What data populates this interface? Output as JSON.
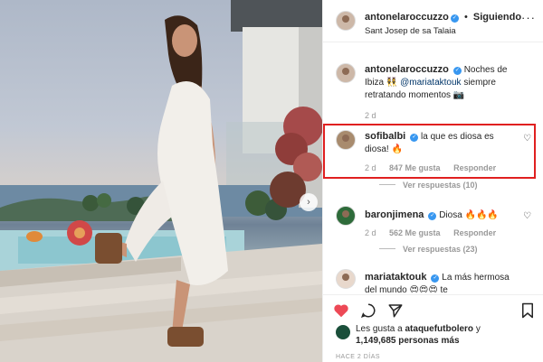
{
  "header": {
    "username": "antonelaroccuzzo",
    "separator": "•",
    "follow_label": "Siguiendo",
    "location": "Sant Josep de sa Talaia"
  },
  "caption": {
    "username": "antonelaroccuzzo",
    "text": "Noches de Ibiza 👯‍♀️ ",
    "mention": "@mariataktouk",
    "text2": " siempre retratando momentos 📷",
    "age": "2 d"
  },
  "comments": [
    {
      "username": "sofibalbi",
      "text": "la que es diosa es diosa! 🔥",
      "age": "2 d",
      "likes": "847 Me gusta",
      "reply": "Responder",
      "view_replies": "Ver respuestas (10)"
    },
    {
      "username": "baronjimena",
      "text": "Diosa 🔥🔥🔥",
      "age": "2 d",
      "likes": "562 Me gusta",
      "reply": "Responder",
      "view_replies": "Ver respuestas (23)"
    },
    {
      "username": "mariataktouk",
      "text": "La más hermosa del mundo 😍😍😍 te"
    }
  ],
  "likes": {
    "prefix": "Les gusta a ",
    "user": "ataquefutbolero",
    "mid": " y",
    "count": "1,149,685 personas más"
  },
  "timestamp": "HACE 2 DÍAS",
  "colors": {
    "liked_heart": "#ed4956",
    "verified": "#3897f0",
    "highlight_box": "#e02020"
  },
  "icons": [
    "heart-icon",
    "comment-icon",
    "share-icon",
    "bookmark-icon",
    "more-icon",
    "chevron-right-icon"
  ]
}
